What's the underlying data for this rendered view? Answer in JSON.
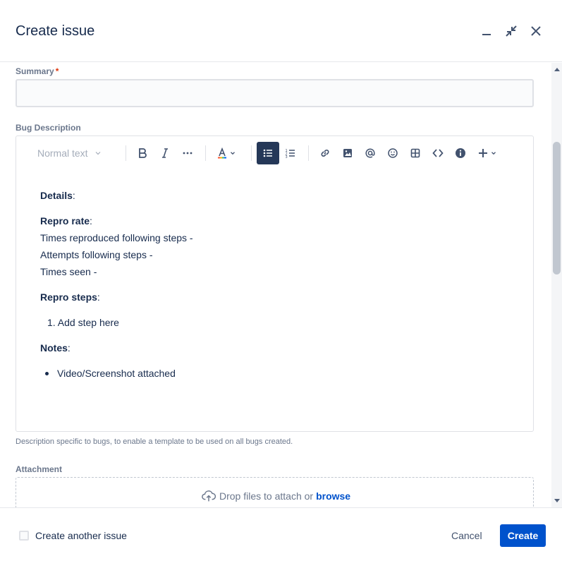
{
  "dialog": {
    "title": "Create issue"
  },
  "summary": {
    "label": "Summary",
    "required_mark": "*",
    "value": "",
    "placeholder": ""
  },
  "description": {
    "label": "Bug Description",
    "toolbar": {
      "text_style": "Normal text"
    },
    "content": {
      "details_heading": "Details",
      "details_colon": ":",
      "repro_rate_heading": "Repro rate",
      "repro_rate_colon": ":",
      "repro_rate_lines": [
        "Times reproduced following steps -",
        "Attempts following steps -",
        "Times seen -"
      ],
      "repro_steps_heading": "Repro steps",
      "repro_steps_colon": ":",
      "repro_steps_list": [
        "1. Add step here"
      ],
      "notes_heading": "Notes",
      "notes_colon": ":",
      "notes_list": [
        "Video/Screenshot attached"
      ]
    },
    "helper_text": "Description specific to bugs, to enable a template to be used on all bugs created."
  },
  "attachment": {
    "label": "Attachment",
    "drop_text": "Drop files to attach or",
    "browse_label": "browse"
  },
  "footer": {
    "create_another_label": "Create another issue",
    "create_another_checked": false,
    "cancel_label": "Cancel",
    "create_label": "Create"
  },
  "colors": {
    "primary": "#0052cc",
    "text": "#172b4d",
    "muted": "#6b778c",
    "required": "#de350b",
    "active_tool": "#253858"
  }
}
